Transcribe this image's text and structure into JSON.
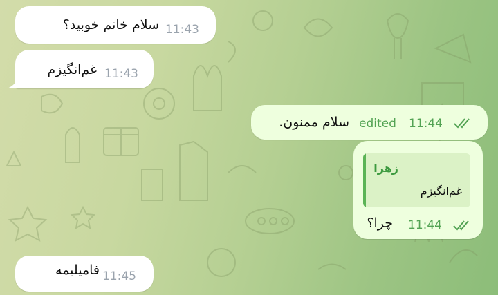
{
  "messages": [
    {
      "direction": "incoming",
      "text": "سلام خانم خوبید؟",
      "time": "11:43"
    },
    {
      "direction": "incoming",
      "text": "غم‌انگیزم",
      "time": "11:43"
    },
    {
      "direction": "outgoing",
      "text": "سلام ممنون.",
      "edited_label": "edited",
      "time": "11:44",
      "status_icon": "double-check-icon"
    },
    {
      "direction": "outgoing",
      "text": "چرا؟",
      "time": "11:44",
      "status_icon": "double-check-icon",
      "reply": {
        "author": "زهرا",
        "text": "غم‌انگیزم"
      }
    },
    {
      "direction": "incoming",
      "text": "فامیلیمه",
      "time": "11:45"
    }
  ],
  "colors": {
    "incoming_bubble": "#ffffff",
    "outgoing_bubble": "#eeffde",
    "outgoing_meta": "#53a354",
    "reply_author": "#3c9a3f",
    "reply_bar": "#5bb456"
  }
}
